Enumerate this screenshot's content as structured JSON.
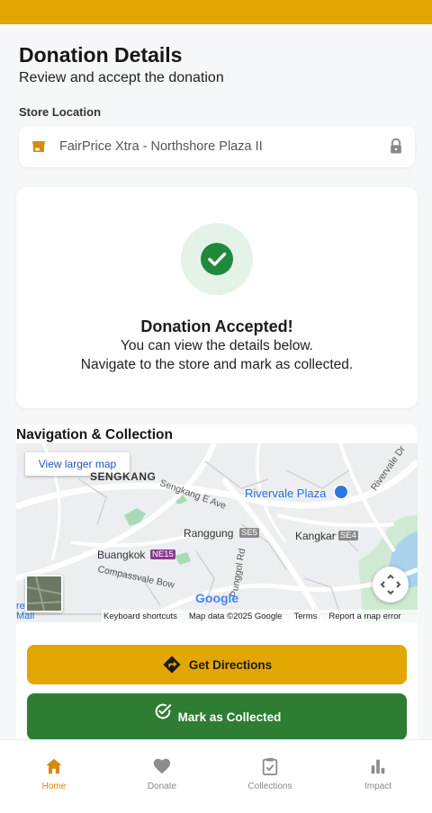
{
  "header": {
    "title": "Donation Details",
    "subtitle": "Review and accept the donation"
  },
  "store": {
    "label": "Store Location",
    "value": "FairPrice Xtra - Northshore Plaza II",
    "icon": "store-icon",
    "lock_icon": "lock-icon"
  },
  "status": {
    "icon": "check-circle-icon",
    "title": "Donation Accepted!",
    "line1": "You can view the details below.",
    "line2": "Navigate to the store and mark as collected."
  },
  "navigation": {
    "title": "Navigation & Collection",
    "map": {
      "view_larger": "View larger map",
      "labels": {
        "sengkang": "SENGKANG",
        "sengkang_e_ave": "Sengkang E Ave",
        "rivervale_plaza": "Rivervale Plaza",
        "rivervale_dr": "Rivervale Dr",
        "ranggung": "Ranggung",
        "kangkar": "Kangkar",
        "buangkok": "Buangkok",
        "compassvale_bow": "Compassvale Bow",
        "punggol_rd": "Punggol Rd",
        "re_mall": "re Mall",
        "se5": "SE5",
        "se4": "SE4",
        "ne15": "NE15"
      },
      "google": "Google",
      "footer": {
        "shortcuts": "Keyboard shortcuts",
        "data": "Map data ©2025 Google",
        "terms": "Terms",
        "report": "Report a map error"
      }
    },
    "get_directions": "Get Directions",
    "mark_collected": "Mark as Collected"
  },
  "bottom_nav": [
    {
      "label": "Home",
      "icon": "home-icon",
      "active": true
    },
    {
      "label": "Donate",
      "icon": "heart-icon",
      "active": false
    },
    {
      "label": "Collections",
      "icon": "clipboard-check-icon",
      "active": false
    },
    {
      "label": "Impact",
      "icon": "bar-chart-icon",
      "active": false
    }
  ],
  "colors": {
    "accent": "#e2a603",
    "success": "#2e7d32",
    "active_nav": "#d58a0a"
  }
}
